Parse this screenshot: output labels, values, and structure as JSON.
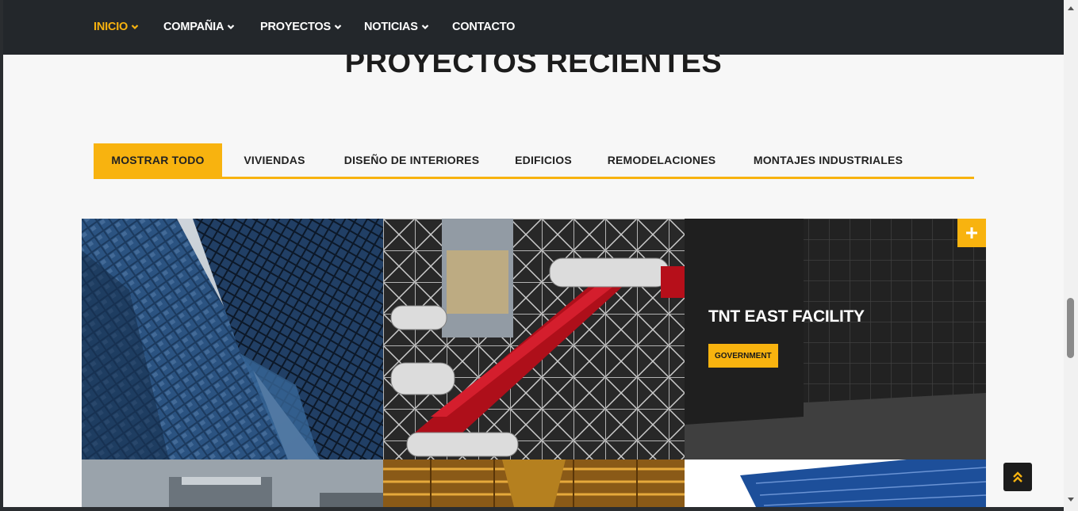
{
  "nav": {
    "items": [
      {
        "label": "INICIO",
        "active": true
      },
      {
        "label": "COMPAÑIA",
        "active": false
      },
      {
        "label": "PROYECTOS",
        "active": false
      },
      {
        "label": "NOTICIAS",
        "active": false
      },
      {
        "label": "CONTACTO",
        "active": false
      }
    ]
  },
  "section": {
    "title": "PROYECTOS RECIENTES"
  },
  "filters": [
    {
      "label": "MOSTRAR TODO",
      "active": true
    },
    {
      "label": "VIVIENDAS",
      "active": false
    },
    {
      "label": "DISEÑO DE INTERIORES",
      "active": false
    },
    {
      "label": "EDIFICIOS",
      "active": false
    },
    {
      "label": "REMODELACIONES",
      "active": false
    },
    {
      "label": "MONTAJES INDUSTRIALES",
      "active": false
    }
  ],
  "projects": [
    {
      "image": "glass-skyscrapers-photo"
    },
    {
      "image": "red-escalator-facade-photo"
    },
    {
      "image": "dark-glass-building-photo",
      "title": "TNT EAST FACILITY",
      "tag": "GOVERNMENT"
    },
    {
      "image": "modern-office-building-photo"
    },
    {
      "image": "wooden-ceiling-interior-photo"
    },
    {
      "image": "blue-glass-tower-photo"
    }
  ],
  "icons": {
    "expand": "plus-icon",
    "back_to_top": "double-chevron-up-icon",
    "dropdown": "chevron-down-icon"
  },
  "colors": {
    "accent": "#f8b30f",
    "nav_bg": "#23272b",
    "page_bg": "#f7f7f7"
  }
}
